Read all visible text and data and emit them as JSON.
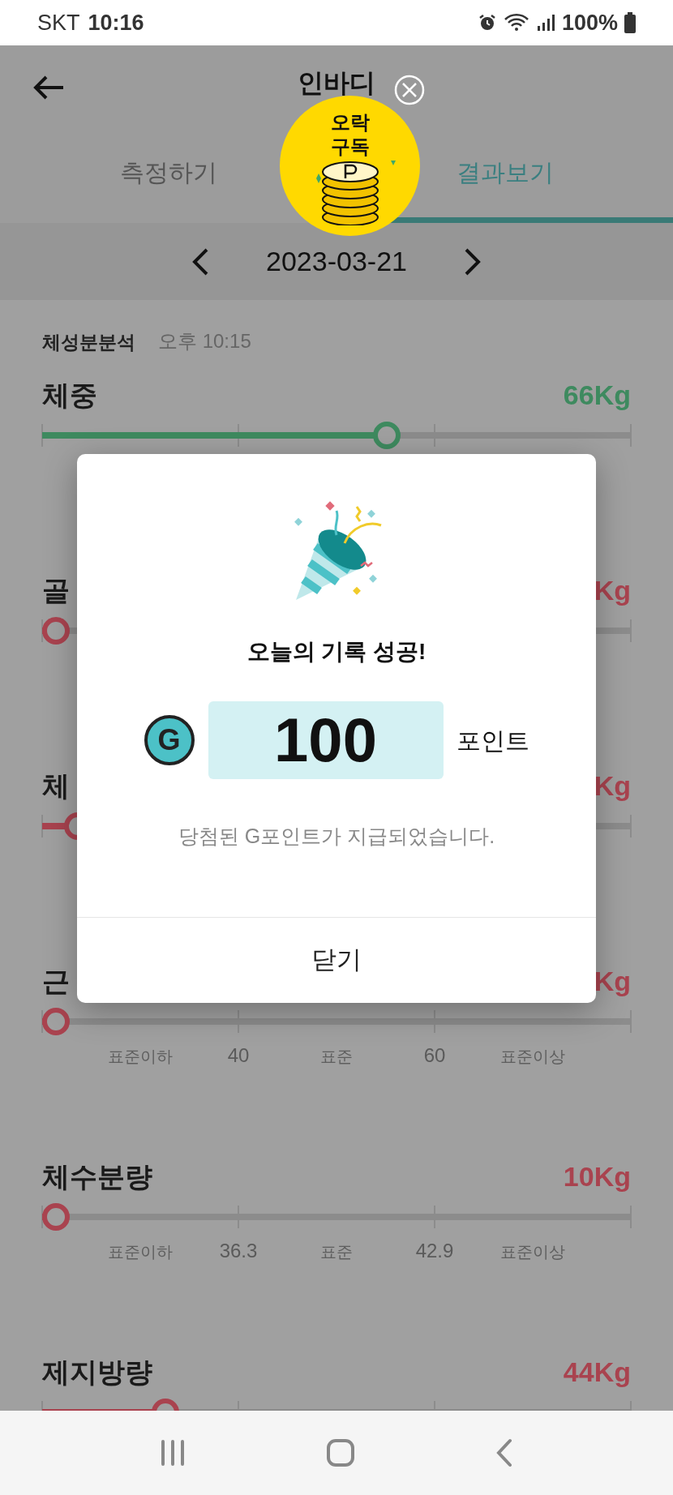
{
  "status_bar": {
    "carrier": "SKT",
    "time": "10:16",
    "battery": "100%"
  },
  "header": {
    "title": "인바디"
  },
  "tabs": [
    {
      "label": "측정하기",
      "selected": false
    },
    {
      "label": "결과보기",
      "selected": true
    }
  ],
  "promo": {
    "lines": [
      "오락",
      "구독"
    ]
  },
  "date_nav": {
    "date": "2023-03-21"
  },
  "section": {
    "title": "체성분분석",
    "time": "오후 10:15"
  },
  "metrics": [
    {
      "name": "체중",
      "value": "66Kg",
      "color": "#3e8a5f",
      "level": 0.585
    },
    {
      "name": "골",
      "value": "Kg",
      "color": "#a9434f",
      "level": 0.02
    },
    {
      "name": "체",
      "value": "Kg",
      "color": "#a9434f",
      "level": 0.06
    },
    {
      "name": "근",
      "value": "Kg",
      "color": "#a9434f",
      "level": 0.02,
      "scale": [
        "표준이하",
        "40",
        "표준",
        "60",
        "표준이상"
      ]
    },
    {
      "name": "체수분량",
      "value": "10Kg",
      "color": "#a9434f",
      "level": 0.02,
      "scale": [
        "표준이하",
        "36.3",
        "표준",
        "42.9",
        "표준이상"
      ]
    },
    {
      "name": "제지방량",
      "value": "44Kg",
      "color": "#a9434f",
      "level": 0.21
    }
  ],
  "dialog": {
    "title": "오늘의 기록 성공!",
    "coin_letter": "G",
    "points": "100",
    "unit": "포인트",
    "message": "당첨된 G포인트가 지급되었습니다.",
    "button": "닫기"
  }
}
